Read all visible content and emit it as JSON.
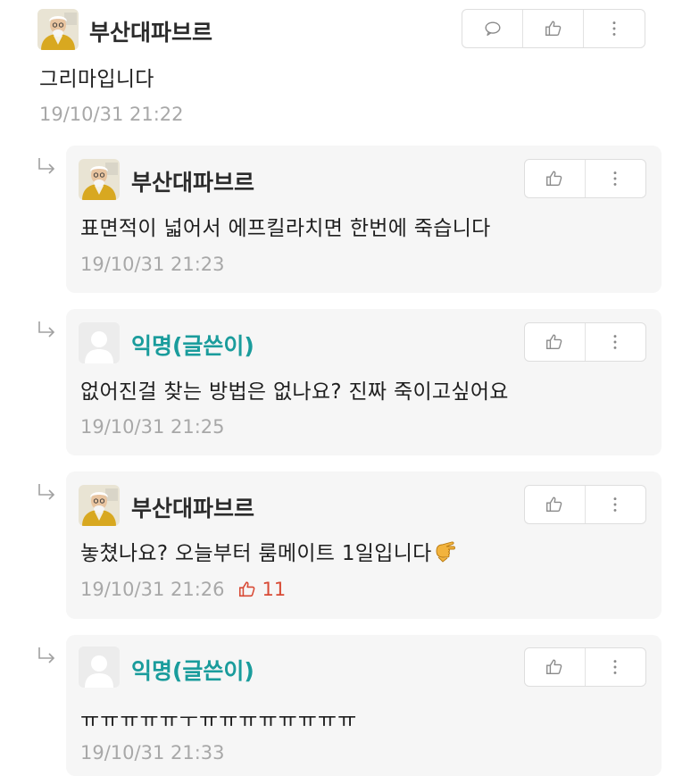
{
  "comments": [
    {
      "author": "부산대파브르",
      "text": "그리마입니다",
      "timestamp": "19/10/31 21:22",
      "is_op": false
    }
  ],
  "replies": [
    {
      "author": "부산대파브르",
      "text": "표면적이 넓어서 에프킬라치면 한번에 죽습니다",
      "timestamp": "19/10/31 21:23",
      "is_op": false
    },
    {
      "author": "익명(글쓴이)",
      "text": "없어진걸 찾는 방법은 없나요? 진짜 죽이고싶어요",
      "timestamp": "19/10/31 21:25",
      "is_op": true
    },
    {
      "author": "부산대파브르",
      "text": "놓쳤나요? 오늘부터 룸메이트 1일입니다",
      "emoji": "pointing-hand-emoji",
      "timestamp": "19/10/31 21:26",
      "likes": "11",
      "is_op": false
    },
    {
      "author": "익명(글쓴이)",
      "text": "ㅠㅠㅠㅠㅠㅜㅠㅠㅠㅠㅠㅠㅠㅠ",
      "timestamp": "19/10/31 21:33",
      "is_op": true
    }
  ],
  "icons": {
    "reply": "speech-bubble-icon",
    "like": "thumbs-up-icon",
    "more": "vertical-dots-icon",
    "reply_arrow": "reply-arrow-icon"
  },
  "colors": {
    "op_name": "#1a9c9c",
    "like_count": "#d84a35",
    "timestamp": "#a8a8a8",
    "reply_bg": "#f6f6f6"
  }
}
